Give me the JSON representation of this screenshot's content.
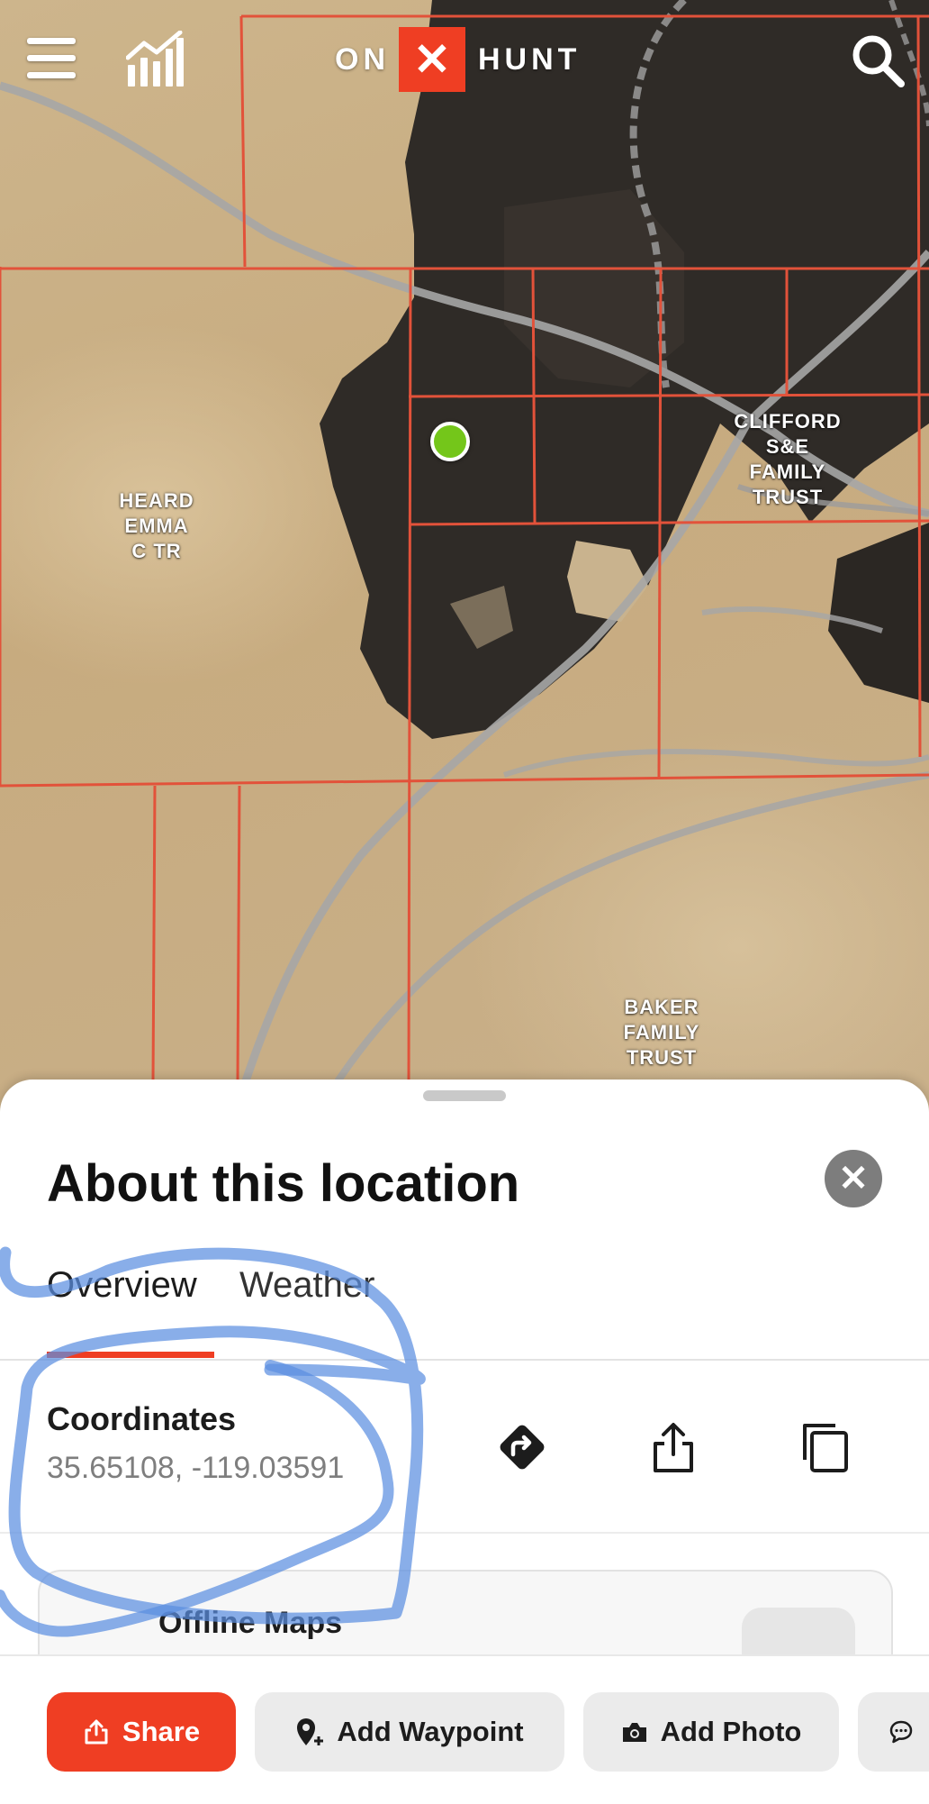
{
  "app": {
    "logo_left": "ON",
    "logo_mark": "✕",
    "logo_right": "HUNT"
  },
  "toolbar": {
    "menu_icon": "hamburger-menu-icon",
    "stats_icon": "bar-chart-icon",
    "search_icon": "search-icon"
  },
  "map": {
    "selected_pin_color": "#74c61a",
    "parcel_line_color": "#e2523a",
    "owners": [
      {
        "name": "HEARD\nEMMA\nC TR"
      },
      {
        "name": "CLIFFORD\nS&E\nFAMILY\nTRUST"
      },
      {
        "name": "BAKER\nFAMILY\nTRUST"
      }
    ]
  },
  "sheet": {
    "title": "About this location",
    "close_icon": "close-icon",
    "tabs": [
      {
        "label": "Overview",
        "active": true
      },
      {
        "label": "Weather",
        "active": false
      }
    ],
    "coordinates": {
      "label": "Coordinates",
      "value": "35.65108, -119.03591"
    },
    "actions": [
      {
        "icon": "directions-icon"
      },
      {
        "icon": "share-icon"
      },
      {
        "icon": "copy-icon"
      }
    ],
    "offline": {
      "title": "Offline Maps"
    }
  },
  "bottom_bar": {
    "share_label": "Share",
    "add_waypoint_label": "Add Waypoint",
    "add_photo_label": "Add Photo",
    "more_icon": "comment-icon"
  },
  "colors": {
    "accent": "#ef3e23",
    "annotation": "#5b8fe0"
  }
}
